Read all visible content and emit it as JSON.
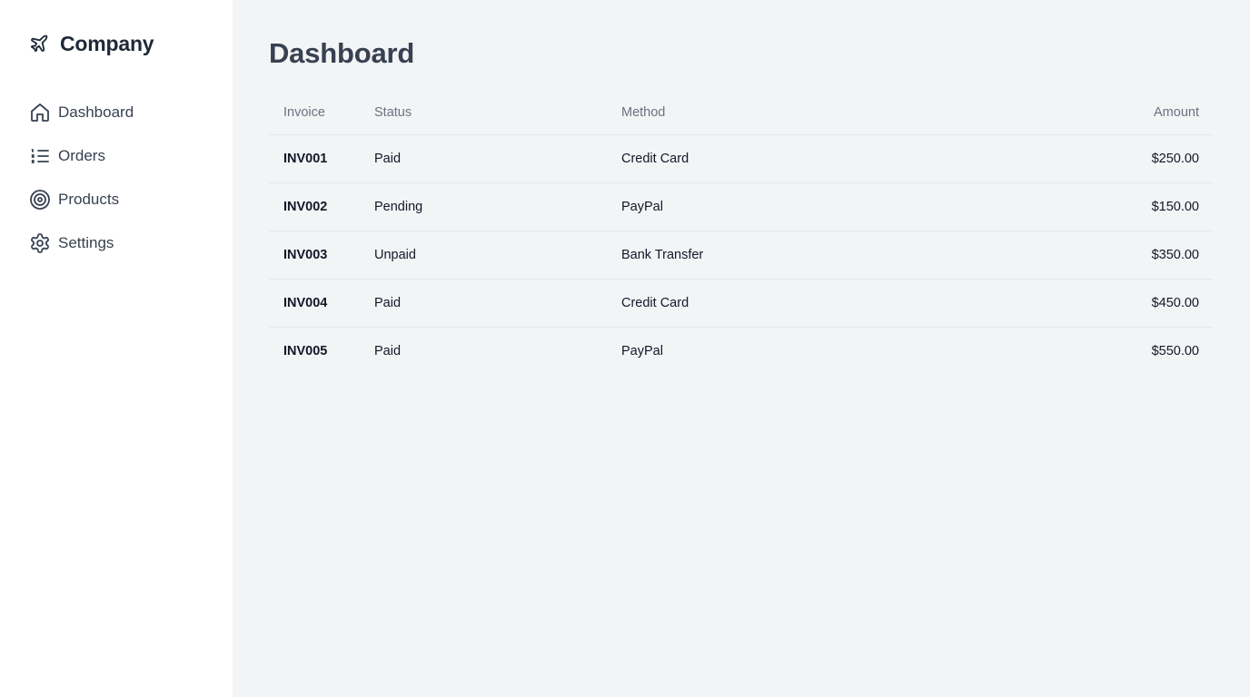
{
  "sidebar": {
    "brand": {
      "name": "Company",
      "icon": "plane-icon"
    },
    "items": [
      {
        "label": "Dashboard",
        "icon": "home-icon"
      },
      {
        "label": "Orders",
        "icon": "list-icon"
      },
      {
        "label": "Products",
        "icon": "target-icon"
      },
      {
        "label": "Settings",
        "icon": "gear-icon"
      }
    ]
  },
  "main": {
    "title": "Dashboard",
    "table": {
      "headers": [
        "Invoice",
        "Status",
        "Method",
        "Amount"
      ],
      "rows": [
        [
          "INV001",
          "Paid",
          "Credit Card",
          "$250.00"
        ],
        [
          "INV002",
          "Pending",
          "PayPal",
          "$150.00"
        ],
        [
          "INV003",
          "Unpaid",
          "Bank Transfer",
          "$350.00"
        ],
        [
          "INV004",
          "Paid",
          "Credit Card",
          "$450.00"
        ],
        [
          "INV005",
          "Paid",
          "PayPal",
          "$550.00"
        ]
      ]
    }
  },
  "colors": {
    "sidebar_bg": "#ffffff",
    "main_bg": "#f3f4f6",
    "text_primary": "#1f2937",
    "text_muted": "#6b7280",
    "border": "#e5e7eb"
  }
}
